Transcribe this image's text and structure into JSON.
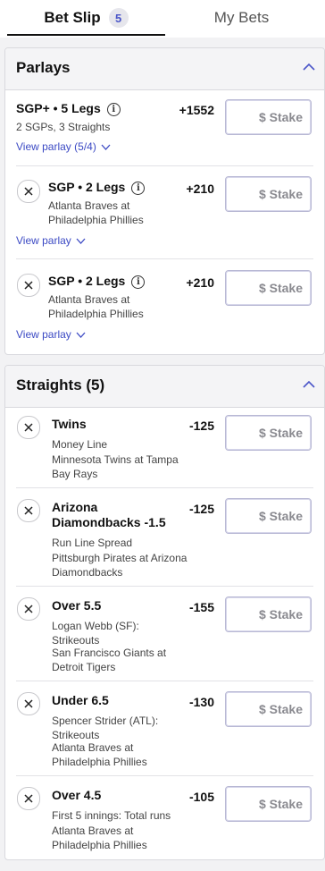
{
  "tabs": {
    "bet_slip": "Bet Slip",
    "bet_count": "5",
    "my_bets": "My Bets"
  },
  "parlays": {
    "title": "Parlays",
    "items": [
      {
        "title": "SGP+ • 5 Legs",
        "subtitle": "2 SGPs, 3 Straights",
        "odds": "+1552",
        "stake_placeholder": "$ Stake",
        "link": "View parlay (5/4)"
      },
      {
        "title": "SGP • 2 Legs",
        "subtitle": "Atlanta Braves at Philadelphia Phillies",
        "odds": "+210",
        "stake_placeholder": "$ Stake",
        "link": "View parlay"
      },
      {
        "title": "SGP • 2 Legs",
        "subtitle": "Atlanta Braves at Philadelphia Phillies",
        "odds": "+210",
        "stake_placeholder": "$ Stake",
        "link": "View parlay"
      }
    ]
  },
  "straights": {
    "title": "Straights (5)",
    "items": [
      {
        "title": "Twins",
        "market": "Money Line",
        "game": "Minnesota Twins at Tampa Bay Rays",
        "odds": "-125",
        "stake_placeholder": "$ Stake"
      },
      {
        "title": "Arizona Diamondbacks -1.5",
        "market": "Run Line Spread",
        "game": "Pittsburgh Pirates at Arizona Diamondbacks",
        "odds": "-125",
        "stake_placeholder": "$ Stake"
      },
      {
        "title": "Over 5.5",
        "market": "Logan Webb (SF): Strikeouts",
        "game": "San Francisco Giants at Detroit Tigers",
        "odds": "-155",
        "stake_placeholder": "$ Stake"
      },
      {
        "title": "Under 6.5",
        "market": "Spencer Strider (ATL): Strikeouts",
        "game": "Atlanta Braves at Philadelphia Phillies",
        "odds": "-130",
        "stake_placeholder": "$ Stake"
      },
      {
        "title": "Over 4.5",
        "market": "First 5 innings: Total runs",
        "game": "Atlanta Braves at Philadelphia Phillies",
        "odds": "-105",
        "stake_placeholder": "$ Stake"
      }
    ]
  },
  "icons": {
    "info": "info-icon",
    "remove": "close-icon",
    "expand": "chevron-down-icon",
    "collapse": "chevron-up-icon"
  },
  "colors": {
    "accent": "#3c4ac4",
    "badge_bg": "#e6e6ec"
  }
}
